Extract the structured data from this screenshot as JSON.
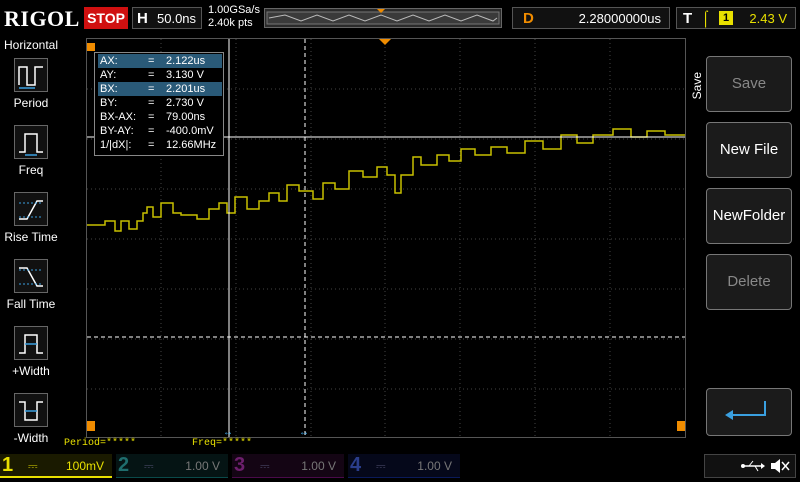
{
  "topbar": {
    "logo": "RIGOL",
    "run_state": "STOP",
    "h_letter": "H",
    "timebase": "50.0ns",
    "sample_rate": "1.00GSa/s",
    "memory_depth": "2.40k pts",
    "d_letter": "D",
    "delay": "2.28000000us",
    "t_letter": "T",
    "trigger_edge_glyph": "⌠",
    "trigger_channel": "1",
    "trigger_level": "2.43 V"
  },
  "left_panel": {
    "title": "Horizontal",
    "items": [
      {
        "label": "Period",
        "icon": "period-icon"
      },
      {
        "label": "Freq",
        "icon": "freq-icon"
      },
      {
        "label": "Rise Time",
        "icon": "rise-time-icon"
      },
      {
        "label": "Fall Time",
        "icon": "fall-time-icon"
      },
      {
        "label": "+Width",
        "icon": "positive-width-icon"
      },
      {
        "label": "-Width",
        "icon": "negative-width-icon"
      }
    ]
  },
  "cursor_readout": {
    "rows": [
      {
        "label": "AX:",
        "eq": "=",
        "value": "2.122us"
      },
      {
        "label": "AY:",
        "eq": "=",
        "value": "3.130 V"
      },
      {
        "label": "BX:",
        "eq": "=",
        "value": "2.201us"
      },
      {
        "label": "BY:",
        "eq": "=",
        "value": "2.730 V"
      },
      {
        "label": "BX-AX:",
        "eq": "=",
        "value": "79.00ns"
      },
      {
        "label": "BY-AY:",
        "eq": "=",
        "value": "-400.0mV"
      },
      {
        "label": "1/|dX|:",
        "eq": "=",
        "value": "12.66MHz"
      }
    ]
  },
  "measurements": {
    "period": "Period=*****",
    "freq": "Freq=*****"
  },
  "right_panel": {
    "title": "Save",
    "buttons": [
      {
        "label": "Save",
        "enabled": false
      },
      {
        "label": "New File",
        "enabled": true
      },
      {
        "label": "NewFolder",
        "enabled": true
      },
      {
        "label": "Delete",
        "enabled": false
      }
    ],
    "back_icon": "return-arrow-icon"
  },
  "channels": [
    {
      "num": "1",
      "scale": "100mV",
      "color": "#e8e000",
      "active": true
    },
    {
      "num": "2",
      "scale": "1.00 V",
      "color": "#00c0c0",
      "active": false
    },
    {
      "num": "3",
      "scale": "1.00 V",
      "color": "#c000c0",
      "active": false
    },
    {
      "num": "4",
      "scale": "1.00 V",
      "color": "#3060ff",
      "active": false
    }
  ],
  "status_icons": [
    "usb-icon",
    "speaker-mute-icon"
  ],
  "colors": {
    "ch1": "#e8e000",
    "cursor_highlight": "#2a5a78",
    "stop": "#d01010",
    "delay_marker": "#f08c00",
    "cursor_marker": "#3aa0e0"
  }
}
